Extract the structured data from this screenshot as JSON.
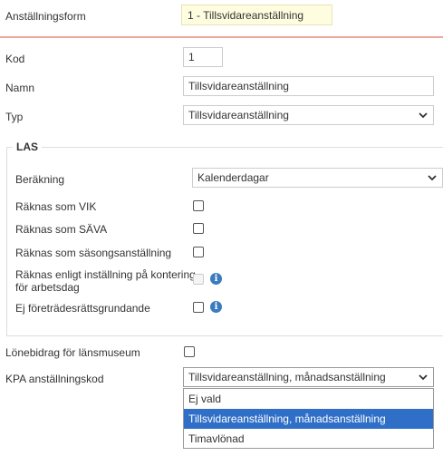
{
  "header": {
    "employment_form_label": "Anställningsform",
    "employment_form_value": "1 - Tillsvidareanställning"
  },
  "form": {
    "code_label": "Kod",
    "code_value": "1",
    "name_label": "Namn",
    "name_value": "Tillsvidareanställning",
    "type_label": "Typ",
    "type_value": "Tillsvidareanställning"
  },
  "las": {
    "legend": "LAS",
    "calc_label": "Beräkning",
    "calc_value": "Kalenderdagar",
    "vik_label": "Räknas som VIK",
    "sava_label": "Räknas som SÄVA",
    "season_label": "Räknas som säsongsanställning",
    "kontering_label_line1": "Räknas enligt inställning på kontering",
    "kontering_label_line2": "för arbetsdag",
    "foretrade_label": "Ej företrädesrättsgrundande",
    "checkboxes": {
      "vik": false,
      "sava": false,
      "season": false,
      "kontering": false,
      "foretrade": false
    }
  },
  "lonebidrag": {
    "label": "Lönebidrag för länsmuseum",
    "checked": false
  },
  "kpa": {
    "label": "KPA anställningskod",
    "value": "Tillsvidareanställning, månadsanställning",
    "options": [
      "Ej vald",
      "Tillsvidareanställning, månadsanställning",
      "Timavlönad"
    ],
    "selected_index": 1
  },
  "icons": {
    "info": "info-icon",
    "chevron": "chevron-down-icon"
  },
  "colors": {
    "accent_divider": "#e8a89a",
    "selected_option": "#2f6fc7",
    "info_icon": "#3b7bbf",
    "readonly_bg": "#fffde0"
  }
}
